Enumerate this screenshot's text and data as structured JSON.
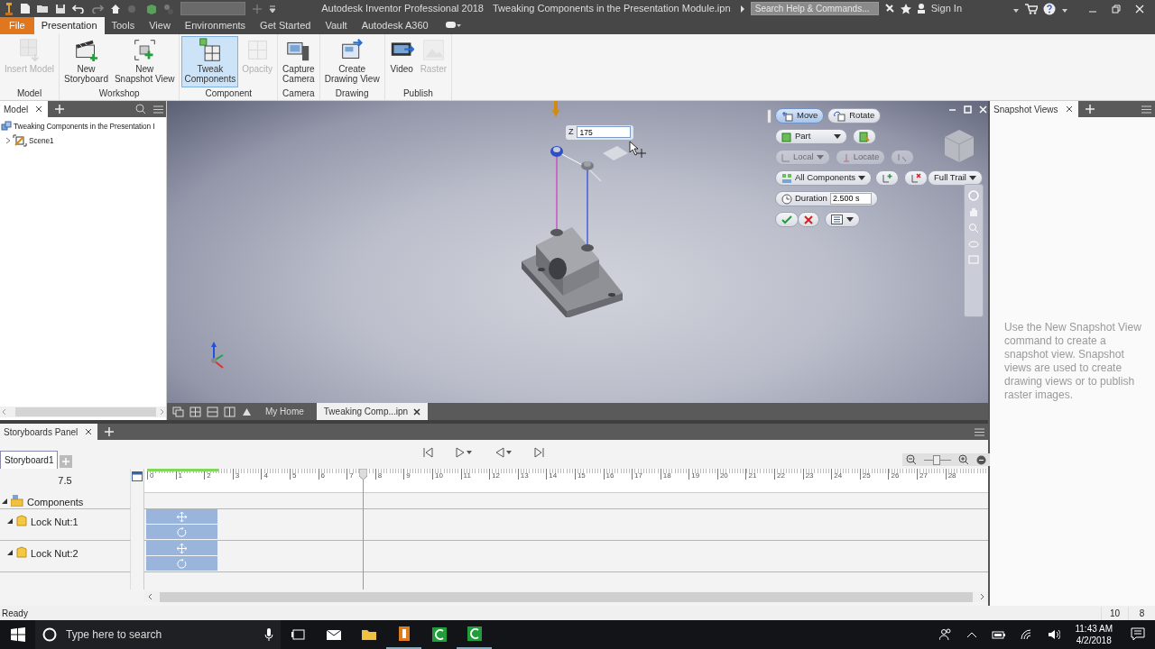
{
  "title_bar": {
    "app_title": "Autodesk Inventor Professional 2018",
    "document_title": "Tweaking Components in the Presentation Module.ipn",
    "search": {
      "placeholder": "Search Help & Commands..."
    },
    "sign_in": "Sign In"
  },
  "ribbon_tabs": [
    {
      "label": "File",
      "kind": "file",
      "selected": false
    },
    {
      "label": "Presentation",
      "kind": "tab",
      "selected": true
    },
    {
      "label": "Tools",
      "kind": "tab",
      "selected": false
    },
    {
      "label": "View",
      "kind": "tab",
      "selected": false
    },
    {
      "label": "Environments",
      "kind": "tab",
      "selected": false
    },
    {
      "label": "Get Started",
      "kind": "tab",
      "selected": false
    },
    {
      "label": "Vault",
      "kind": "tab",
      "selected": false
    },
    {
      "label": "Autodesk A360",
      "kind": "tab",
      "selected": false
    }
  ],
  "ribbon_groups": [
    {
      "label": "Model",
      "buttons": [
        {
          "lines": [
            "Insert Model"
          ],
          "kind": "insert",
          "disabled": true,
          "selected": false
        }
      ]
    },
    {
      "label": "Workshop",
      "buttons": [
        {
          "lines": [
            "New",
            "Storyboard"
          ],
          "kind": "storyboard",
          "disabled": false,
          "selected": false
        },
        {
          "lines": [
            "New",
            "Snapshot View"
          ],
          "kind": "snapshot",
          "disabled": false,
          "selected": false
        }
      ]
    },
    {
      "label": "Component",
      "buttons": [
        {
          "lines": [
            "Tweak",
            "Components"
          ],
          "kind": "tweak",
          "disabled": false,
          "selected": true
        },
        {
          "lines": [
            "Opacity"
          ],
          "kind": "opacity",
          "disabled": true,
          "selected": false
        }
      ]
    },
    {
      "label": "Camera",
      "buttons": [
        {
          "lines": [
            "Capture",
            "Camera"
          ],
          "kind": "camera",
          "disabled": false,
          "selected": false
        }
      ]
    },
    {
      "label": "Drawing",
      "buttons": [
        {
          "lines": [
            "Create",
            "Drawing View"
          ],
          "kind": "drawing",
          "disabled": false,
          "selected": false
        }
      ]
    },
    {
      "label": "Publish",
      "buttons": [
        {
          "lines": [
            "Video"
          ],
          "kind": "video",
          "disabled": false,
          "selected": false
        },
        {
          "lines": [
            "Raster"
          ],
          "kind": "raster",
          "disabled": true,
          "selected": false
        }
      ]
    }
  ],
  "model_browser": {
    "tab": "Model",
    "tree": [
      {
        "label": "Tweaking Components in the Presentation I",
        "kind": "document",
        "children": [
          {
            "label": "Scene1",
            "kind": "scene",
            "expanded": false
          }
        ]
      }
    ]
  },
  "viewport": {
    "z_label": "Z",
    "z_value": "175",
    "mini_toolbar": {
      "modes": [
        {
          "label": "Move",
          "selected": true
        },
        {
          "label": "Rotate",
          "selected": false
        }
      ],
      "selection": "Part",
      "coordinates": {
        "label": "Local",
        "disabled": true
      },
      "locate": {
        "label": "Locate",
        "disabled": true
      },
      "components": "All Components",
      "trail": "Full Trail",
      "duration_label": "Duration",
      "duration_value": "2.500 s"
    }
  },
  "document_tabs": [
    {
      "label": "My Home",
      "selected": false
    },
    {
      "label": "Tweaking Comp...ipn",
      "selected": true
    }
  ],
  "storyboards": {
    "tab": "Storyboards Panel",
    "storyboard_tabs": [
      {
        "label": "Storyboard1",
        "selected": true
      }
    ],
    "current_time": "7.5",
    "zoom": {
      "level": 0.45
    },
    "ruler_labels": [
      "0",
      "1",
      "2",
      "3",
      "4",
      "5",
      "6",
      "7",
      "8",
      "9",
      "10",
      "11",
      "12",
      "13",
      "14",
      "15",
      "16",
      "17",
      "18",
      "19",
      "20",
      "21",
      "22",
      "23",
      "24",
      "25",
      "26",
      "27",
      "28"
    ],
    "tracks": [
      {
        "label": "Components",
        "kind": "group",
        "expanded": true,
        "children": [
          {
            "label": "Lock Nut:1",
            "kind": "component",
            "expanded": true,
            "actions": [
              {
                "kind": "move"
              },
              {
                "kind": "rotate"
              }
            ]
          },
          {
            "label": "Lock Nut:2",
            "kind": "component",
            "expanded": true,
            "actions": [
              {
                "kind": "move"
              },
              {
                "kind": "rotate"
              }
            ]
          }
        ]
      }
    ]
  },
  "snapshot_panel": {
    "tab": "Snapshot Views",
    "message": "Use the New Snapshot View command to create a snapshot view. Snapshot views are used to create drawing views or to publish raster images."
  },
  "status_bar": {
    "text": "Ready",
    "fields": [
      "10",
      "8"
    ]
  },
  "taskbar": {
    "search": {
      "placeholder": "Type here to search"
    },
    "time": "11:43 AM",
    "date": "4/2/2018"
  }
}
